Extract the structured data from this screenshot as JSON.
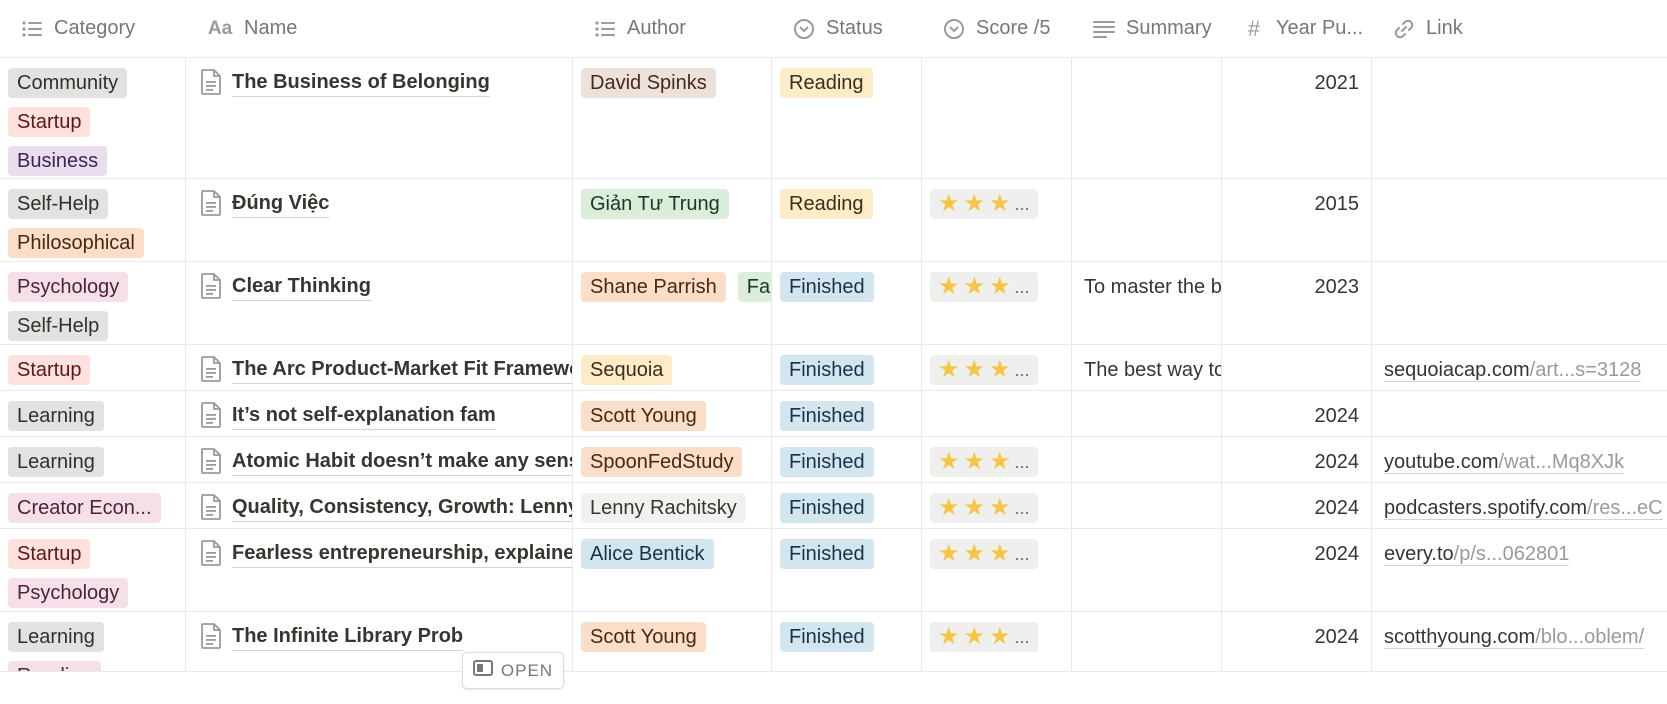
{
  "columns": [
    {
      "label": "Category",
      "icon": "list-icon"
    },
    {
      "label": "Name",
      "icon": "text-icon"
    },
    {
      "label": "Author",
      "icon": "list-icon"
    },
    {
      "label": "Status",
      "icon": "status-icon"
    },
    {
      "label": "Score /5",
      "icon": "status-icon"
    },
    {
      "label": "Summary",
      "icon": "lines-icon"
    },
    {
      "label": "Year Pu...",
      "icon": "hash-icon"
    },
    {
      "label": "Link",
      "icon": "link-icon"
    }
  ],
  "icon_glyphs": {
    "text-icon": "Aa",
    "hash-icon": "#"
  },
  "colors": {
    "gray": "#e3e2e0",
    "red": "#ffe2dd",
    "purple": "#e8deee",
    "orange": "#fadec9",
    "green": "#dbeddb",
    "pink": "#f5e0e9",
    "yellow": "#fdecc8",
    "blue": "#d3e5ef",
    "brown": "#eee0da",
    "lightgray": "#f1f1ef",
    "text_gray": "#32302c",
    "text_red": "#5d1715",
    "text_purple": "#412454",
    "text_orange": "#49290e",
    "text_green": "#1c3829",
    "text_pink": "#4c2337",
    "text_yellow": "#402c1b",
    "text_blue": "#183347",
    "text_brown": "#442a1e",
    "star": "#f6c544"
  },
  "stars_suffix": "...",
  "open_button": {
    "label": "OPEN"
  },
  "rows": [
    {
      "categories": [
        {
          "label": "Community",
          "color": "gray"
        },
        {
          "label": "Startup",
          "color": "red"
        },
        {
          "label": "Business",
          "color": "purple"
        }
      ],
      "name": "The Business of Belonging",
      "authors": [
        {
          "label": "David Spinks",
          "color": "brown"
        }
      ],
      "status": {
        "label": "Reading",
        "color": "yellow"
      },
      "score": null,
      "summary": "",
      "year": "2021",
      "link": null
    },
    {
      "categories": [
        {
          "label": "Self-Help",
          "color": "gray"
        },
        {
          "label": "Philosophical",
          "color": "orange"
        }
      ],
      "name": "Đúng Việc",
      "authors": [
        {
          "label": "Giản Tư Trung",
          "color": "green"
        }
      ],
      "status": {
        "label": "Reading",
        "color": "yellow"
      },
      "score": 3,
      "summary": "",
      "year": "2015",
      "link": null
    },
    {
      "categories": [
        {
          "label": "Psychology",
          "color": "pink"
        },
        {
          "label": "Self-Help",
          "color": "gray"
        }
      ],
      "name": "Clear Thinking",
      "authors": [
        {
          "label": "Shane Parrish",
          "color": "orange"
        },
        {
          "label": "Fa",
          "color": "green"
        }
      ],
      "status": {
        "label": "Finished",
        "color": "blue"
      },
      "score": 3,
      "summary": "To master the b",
      "year": "2023",
      "link": null
    },
    {
      "categories": [
        {
          "label": "Startup",
          "color": "red"
        }
      ],
      "name": "The Arc Product-Market Fit Framewo",
      "authors": [
        {
          "label": "Sequoia",
          "color": "yellow"
        }
      ],
      "status": {
        "label": "Finished",
        "color": "blue"
      },
      "score": 3,
      "summary": "The best way to",
      "year": "",
      "link": {
        "domain": "sequoiacap.com",
        "path": "/art...s=3128"
      }
    },
    {
      "categories": [
        {
          "label": "Learning",
          "color": "gray"
        }
      ],
      "name": "It’s not self-explanation fam",
      "authors": [
        {
          "label": "Scott Young",
          "color": "orange"
        }
      ],
      "status": {
        "label": "Finished",
        "color": "blue"
      },
      "score": null,
      "summary": "",
      "year": "2024",
      "link": null
    },
    {
      "categories": [
        {
          "label": "Learning",
          "color": "gray"
        }
      ],
      "name": "Atomic Habit doesn’t make any sens",
      "authors": [
        {
          "label": "SpoonFedStudy",
          "color": "orange"
        }
      ],
      "status": {
        "label": "Finished",
        "color": "blue"
      },
      "score": 3,
      "summary": "",
      "year": "2024",
      "link": {
        "domain": "youtube.com",
        "path": "/wat...Mq8XJk"
      }
    },
    {
      "categories": [
        {
          "label": "Creator Econ...",
          "color": "pink"
        }
      ],
      "name": "Quality, Consistency, Growth: Lenny",
      "authors": [
        {
          "label": "Lenny Rachitsky",
          "color": "lightgray"
        }
      ],
      "status": {
        "label": "Finished",
        "color": "blue"
      },
      "score": 3,
      "summary": "",
      "year": "2024",
      "link": {
        "domain": "podcasters.spotify.com",
        "path": "/res...eC"
      }
    },
    {
      "categories": [
        {
          "label": "Startup",
          "color": "red"
        },
        {
          "label": "Psychology",
          "color": "pink"
        }
      ],
      "name": "Fearless entrepreneurship, explained",
      "authors": [
        {
          "label": "Alice Bentick",
          "color": "blue"
        }
      ],
      "status": {
        "label": "Finished",
        "color": "blue"
      },
      "score": 3,
      "summary": "",
      "year": "2024",
      "link": {
        "domain": "every.to",
        "path": "/p/s...062801"
      }
    },
    {
      "categories": [
        {
          "label": "Learning",
          "color": "gray"
        },
        {
          "label": "Reading",
          "color": "pink"
        }
      ],
      "name": "The Infinite Library Prob",
      "authors": [
        {
          "label": "Scott Young",
          "color": "orange"
        }
      ],
      "status": {
        "label": "Finished",
        "color": "blue"
      },
      "score": 3,
      "summary": "",
      "year": "2024",
      "link": {
        "domain": "scotthyoung.com",
        "path": "/blo...oblem/"
      }
    }
  ]
}
